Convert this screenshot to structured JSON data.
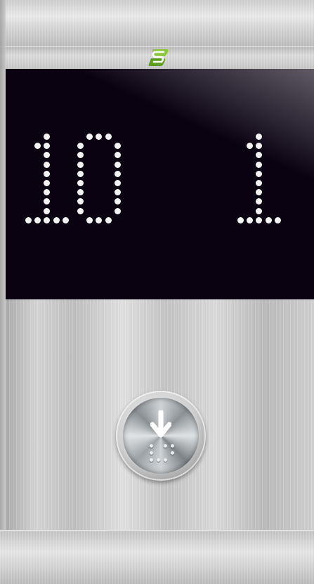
{
  "floor_display": {
    "floor_number": "10",
    "floor_number_2": "1"
  },
  "logo": {
    "icon": "brand-s-logo",
    "color": "#7bbf2a"
  },
  "display": {
    "background": "#0a0210",
    "dot_color": "#f4f4f4"
  },
  "call_button": {
    "icon": "down-arrow-icon",
    "braille_icon": "braille-dots-icon"
  }
}
